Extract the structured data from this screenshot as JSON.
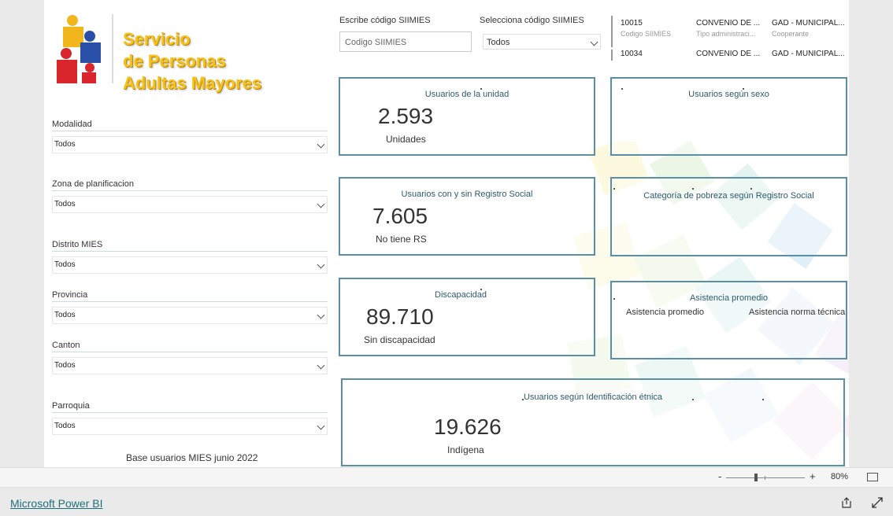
{
  "logo": {
    "line1": "Servicio",
    "line2": "de Personas",
    "line3": "Adultas Mayores"
  },
  "search": {
    "label": "Escribe código SIIMIES",
    "placeholder": "Codigo SIIMIES"
  },
  "select_code": {
    "label": "Selecciona código SIIMIES",
    "value": "Todos"
  },
  "table": {
    "rows": [
      {
        "code": "10015",
        "code_sub": "Codigo SIIMIES",
        "tipo": "CONVENIO DE ...",
        "tipo_sub": "Tipo administraci...",
        "coop": "GAD - MUNICIPAL...",
        "coop_sub": "Cooperante"
      },
      {
        "code": "10034",
        "tipo": "CONVENIO DE ...",
        "coop": "GAD - MUNICIPAL..."
      }
    ]
  },
  "slicers": [
    {
      "label": "Modalidad",
      "value": "Todos"
    },
    {
      "label": "Zona de planificacion",
      "value": "Todos"
    },
    {
      "label": "Distrito MIES",
      "value": "Todos"
    },
    {
      "label": "Provincia",
      "value": "Todos"
    },
    {
      "label": "Canton",
      "value": "Todos"
    },
    {
      "label": "Parroquia",
      "value": "Todos"
    }
  ],
  "base_note": "Base usuarios MIES junio 2022",
  "cards": {
    "usuarios_unidad": {
      "title": "Usuarios de la unidad",
      "value": "2.593",
      "caption": "Unidades"
    },
    "registro_social": {
      "title": "Usuarios con y sin Registro Social",
      "value": "7.605",
      "caption": "No tiene RS"
    },
    "discapacidad": {
      "title": "Discapacidad",
      "value": "89.710",
      "caption": "Sin discapacidad"
    },
    "etnica": {
      "title": "Usuarios según Identificación étnica",
      "value": "19.626",
      "caption": "Indígena"
    },
    "sexo": {
      "title": "Usuarios según sexo"
    },
    "pobreza": {
      "title": "Categoría de pobreza según Registro Social"
    },
    "asistencia": {
      "title": "Asistencia promedio",
      "col1": "Asistencia promedio",
      "col2": "Asistencia norma técnica"
    }
  },
  "zoom": {
    "minus": "-",
    "plus": "+",
    "percent": "80%"
  },
  "footer": {
    "link": "Microsoft Power BI"
  },
  "colors": {
    "card_border": "#5b8fa8",
    "logo_text": "#f6c21a",
    "link": "#1f6f7a"
  }
}
